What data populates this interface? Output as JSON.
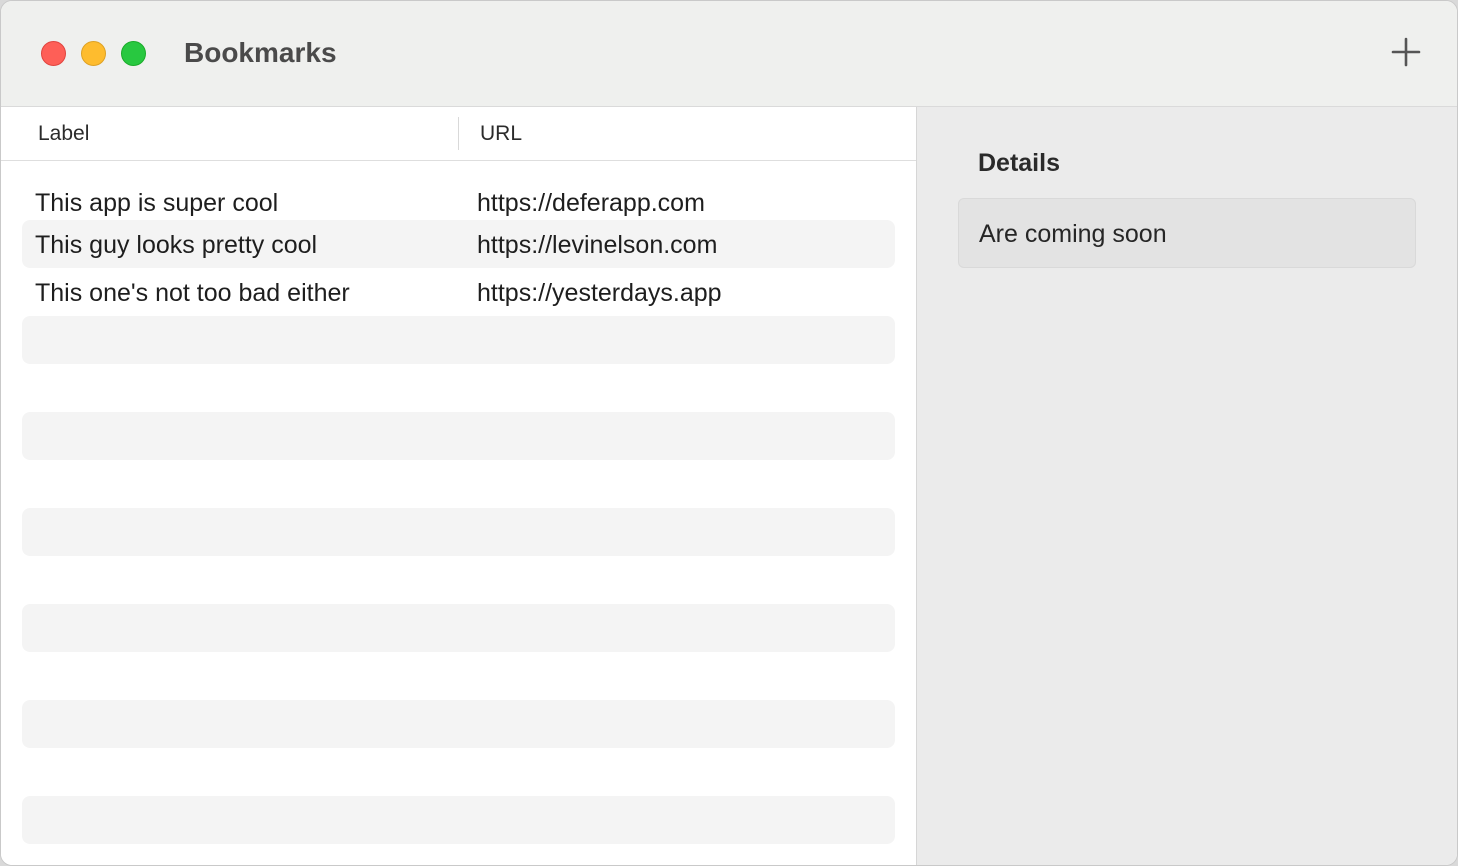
{
  "window": {
    "title": "Bookmarks",
    "add_icon": "plus-icon"
  },
  "table": {
    "columns": [
      "Label",
      "URL"
    ],
    "rows": [
      {
        "label": "This app is super cool",
        "url": "https://deferapp.com"
      },
      {
        "label": "This guy looks pretty cool",
        "url": "https://levinelson.com"
      },
      {
        "label": "This one's not too bad either",
        "url": "https://yesterdays.app"
      }
    ]
  },
  "details": {
    "title": "Details",
    "text": "Are coming soon"
  },
  "colors": {
    "close": "#fe5f57",
    "minimize": "#febc2e",
    "maximize": "#28c840",
    "alt_row": "#f4f4f4",
    "sidebar_bg": "#ebebeb"
  }
}
